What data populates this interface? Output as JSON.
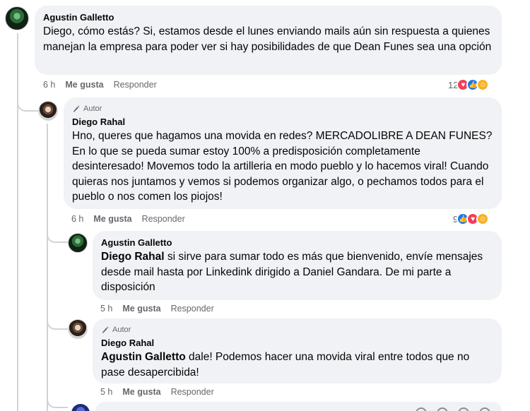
{
  "comments": [
    {
      "author": "Agustin Galletto",
      "text": "Diego, cómo estás? Si, estamos desde el lunes enviando mails aún sin respuesta a quienes manejan la empresa para poder ver si hay posibilidades de que Dean Funes sea una opción",
      "time": "6 h",
      "like_label": "Me gusta",
      "reply_label": "Responder",
      "reaction_count": "12",
      "reaction_icons": [
        "love-icon",
        "like-icon",
        "care-icon"
      ]
    },
    {
      "badge": "Autor",
      "author": "Diego Rahal",
      "text": "Hno, queres que hagamos una movida en redes? MERCADOLIBRE A DEAN FUNES? En lo que se pueda sumar estoy 100% a predisposición completamente desinteresado! Movemos todo la artilleria en modo pueblo y lo hacemos viral! Cuando quieras nos juntamos y vemos si podemos organizar algo, o pechamos todos para el pueblo o nos comen los piojos!",
      "time": "6 h",
      "like_label": "Me gusta",
      "reply_label": "Responder",
      "reaction_count": "9",
      "reaction_icons": [
        "like-icon",
        "love-icon",
        "care-icon"
      ]
    },
    {
      "author": "Agustin Galletto",
      "mention": "Diego Rahal",
      "text": " si sirve para sumar todo es más que bienvenido, envíe mensajes desde mail hasta por Linkedink dirigido a Daniel Gandara. De mi parte a disposición",
      "time": "5 h",
      "like_label": "Me gusta",
      "reply_label": "Responder"
    },
    {
      "badge": "Autor",
      "author": "Diego Rahal",
      "mention": "Agustin Galletto",
      "text": " dale! Podemos hacer una movida viral entre todos que no pase desapercibida!",
      "time": "5 h",
      "like_label": "Me gusta",
      "reply_label": "Responder"
    }
  ],
  "colors": {
    "bubble": "#f0f2f5",
    "meta": "#65676b",
    "love": "#f33e58",
    "like": "#1877f2",
    "care": "#f7b125"
  }
}
